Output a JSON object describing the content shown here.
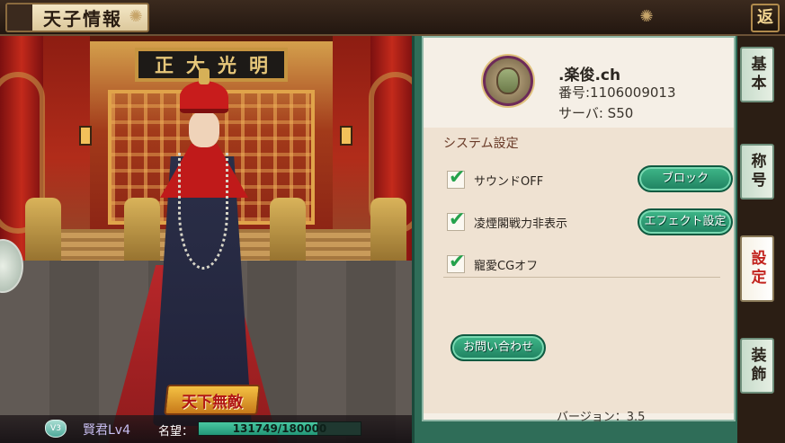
{
  "header": {
    "title": "天子情報",
    "return_label": "返"
  },
  "scene": {
    "plaque_text": "正大光明",
    "badge_text": "天下無敵"
  },
  "status": {
    "level_icon_text": "V3",
    "level_text": "賢君Lv4",
    "fame_label": "名望：",
    "fame_value": "131749/180000",
    "fame_current": 131749,
    "fame_max": 180000
  },
  "profile": {
    "name": ".楽俊.ch",
    "id_text": "番号:1106009013",
    "server_text": "サーバ: S50"
  },
  "settings": {
    "section_title": "システム設定",
    "options": [
      {
        "label": "サウンドOFF",
        "checked": true
      },
      {
        "label": "凌煙閣戦力非表示",
        "checked": true
      },
      {
        "label": "寵愛CGオフ",
        "checked": true
      }
    ],
    "buttons": {
      "block": "ブロック",
      "effect": "エフェクト設定",
      "contact": "お問い合わせ"
    },
    "version_text": "バージョン：3.5"
  },
  "tabs": [
    {
      "label": "基本",
      "active": false
    },
    {
      "label": "称号",
      "active": false
    },
    {
      "label": "設定",
      "active": true
    },
    {
      "label": "装飾",
      "active": false
    }
  ],
  "colors": {
    "accent_green": "#2f9a74",
    "active_tab_text": "#c2231e",
    "check_green": "#25a24c"
  }
}
